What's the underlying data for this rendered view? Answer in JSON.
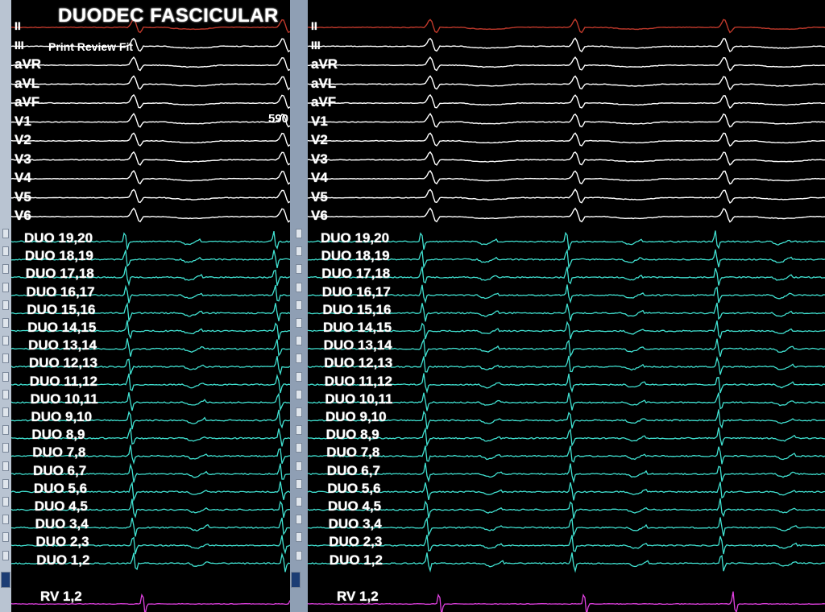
{
  "window": {
    "title": "DUODEC FASCICULAR"
  },
  "menu": {
    "items": "Print Review Fit"
  },
  "measurement": {
    "cycle_length": "590"
  },
  "channels": {
    "surface": [
      "II",
      "III",
      "aVR",
      "aVL",
      "aVF",
      "V1",
      "V2",
      "V3",
      "V4",
      "V5",
      "V6"
    ],
    "duodecapolar": [
      "DUO 19,20",
      "DUO 18,19",
      "DUO 17,18",
      "DUO 16,17",
      "DUO 15,16",
      "DUO 14,15",
      "DUO 13,14",
      "DUO 12,13",
      "DUO 11,12",
      "DUO 10,11",
      "DUO 9,10",
      "DUO 8,9",
      "DUO 7,8",
      "DUO 6,7",
      "DUO 5,6",
      "DUO 4,5",
      "DUO 3,4",
      "DUO 2,3",
      "DUO 1,2"
    ],
    "rv": "RV 1,2"
  },
  "colors": {
    "background": "#000000",
    "surface_trace": "#ffffff",
    "first_trace": "#c0392b",
    "duo_trace": "#40e0d0",
    "rv_trace": "#e040e0",
    "label": "#ffffff"
  }
}
